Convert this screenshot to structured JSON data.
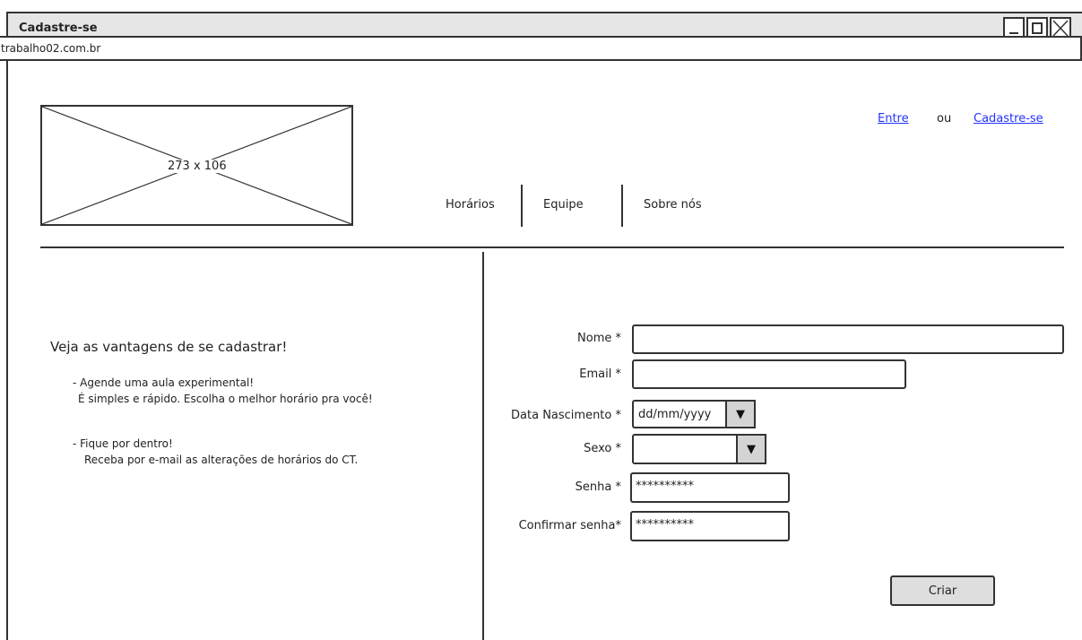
{
  "window": {
    "title": "Cadastre-se",
    "url": "trabalho02.com.br"
  },
  "header": {
    "logo_placeholder": "273 x 106",
    "auth": {
      "login_label": "Entre",
      "or_label": "ou",
      "signup_label": "Cadastre-se"
    },
    "nav": [
      "Horários",
      "Equipe",
      "Sobre nós"
    ]
  },
  "promo": {
    "heading": "Veja as vantagens de se cadastrar!",
    "items": [
      {
        "title": "- Agende uma aula experimental!",
        "text": "É simples e rápido. Escolha o melhor horário pra você!"
      },
      {
        "title": "- Fique por dentro!",
        "text": "Receba por e-mail as alterações de horários do CT."
      }
    ]
  },
  "form": {
    "name_label": "Nome *",
    "email_label": "Email *",
    "birth_label": "Data Nascimento *",
    "birth_value": "dd/mm/yyyy",
    "sex_label": "Sexo *",
    "sex_value": "",
    "password_label": "Senha *",
    "password_value": "**********",
    "confirm_label": "Confirmar senha*",
    "confirm_value": "**********",
    "submit_label": "Criar"
  },
  "icons": {
    "dropdown": "chevron-down-icon",
    "close": "close-icon",
    "minimize": "minimize-icon",
    "maximize": "maximize-icon"
  },
  "colors": {
    "link": "#2233ff",
    "titlebar": "#e6e6e6",
    "button": "#dedede"
  }
}
